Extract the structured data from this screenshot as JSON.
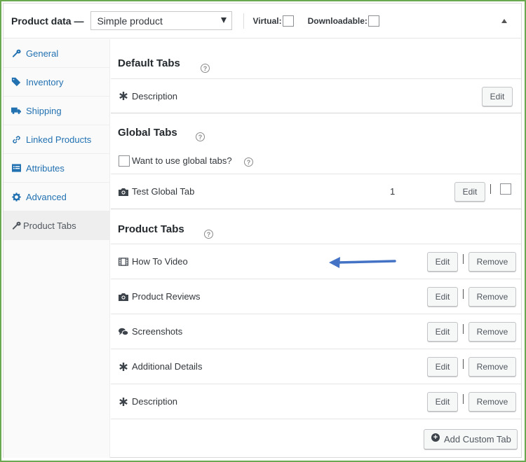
{
  "header": {
    "title": "Product data —",
    "product_type": "Simple product",
    "virtual_label": "Virtual:",
    "downloadable_label": "Downloadable:"
  },
  "sidebar": {
    "items": [
      {
        "label": "General",
        "icon": "wrench-icon"
      },
      {
        "label": "Inventory",
        "icon": "tag-icon"
      },
      {
        "label": "Shipping",
        "icon": "truck-icon"
      },
      {
        "label": "Linked Products",
        "icon": "link-icon"
      },
      {
        "label": "Attributes",
        "icon": "list-icon"
      },
      {
        "label": "Advanced",
        "icon": "gear-icon"
      },
      {
        "label": "Product Tabs",
        "icon": "wrench-icon",
        "active": true
      }
    ]
  },
  "default_tabs": {
    "heading": "Default Tabs",
    "rows": [
      {
        "label": "Description",
        "icon": "asterisk-icon",
        "edit": "Edit"
      }
    ]
  },
  "global_tabs": {
    "heading": "Global Tabs",
    "checkbox_label": "Want to use global tabs?",
    "rows": [
      {
        "label": "Test Global Tab",
        "icon": "camera-icon",
        "count": "1",
        "edit": "Edit"
      }
    ]
  },
  "product_tabs": {
    "heading": "Product Tabs",
    "rows": [
      {
        "label": "How To Video",
        "icon": "film-icon",
        "edit": "Edit",
        "remove": "Remove"
      },
      {
        "label": "Product Reviews",
        "icon": "camera-icon",
        "edit": "Edit",
        "remove": "Remove"
      },
      {
        "label": "Screenshots",
        "icon": "chat-icon",
        "edit": "Edit",
        "remove": "Remove"
      },
      {
        "label": "Additional Details",
        "icon": "asterisk-icon",
        "edit": "Edit",
        "remove": "Remove"
      },
      {
        "label": "Description",
        "icon": "asterisk-icon",
        "edit": "Edit",
        "remove": "Remove"
      }
    ],
    "add_button": "Add Custom Tab"
  },
  "colors": {
    "link": "#2271b1",
    "arrow": "#4472c4",
    "frame": "#6aa84f"
  }
}
